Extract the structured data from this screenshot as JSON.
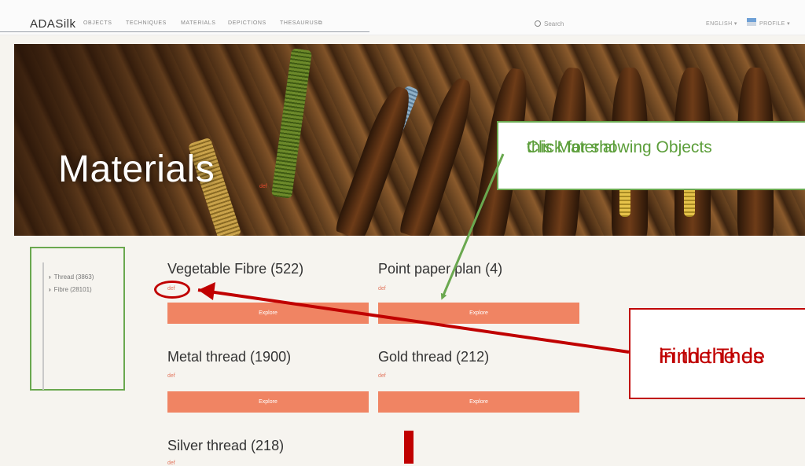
{
  "topbar": {
    "logo": "ADASilk",
    "nav": [
      "OBJECTS",
      "TECHNIQUES",
      "MATERIALS",
      "DEPICTIONS",
      "THESAURUS⧉"
    ],
    "search_placeholder": "Search",
    "language": "ENGLISH ▾",
    "profile": "PROFILE ▾"
  },
  "hero": {
    "title": "Materials",
    "def_link": "def"
  },
  "sidebar": {
    "items": [
      {
        "label": "Thread (3863)"
      },
      {
        "label": "Fibre (28101)"
      }
    ]
  },
  "cards": [
    {
      "title": "Vegetable Fibre (522)",
      "def": "def",
      "button": "Explore"
    },
    {
      "title": "Point paper plan (4)",
      "def": "def",
      "button": "Explore"
    },
    {
      "title": "Metal thread (1900)",
      "def": "def",
      "button": "Explore"
    },
    {
      "title": "Gold thread (212)",
      "def": "def",
      "button": "Explore"
    },
    {
      "title": "Silver thread (218)",
      "def": "def"
    }
  ],
  "annotations": {
    "objects_callout_line1": "Click for showing Objects",
    "objects_callout_line2": "this Material",
    "thesaurus_callout_line1": "Find the de",
    "thesaurus_callout_line2": "in the Thes"
  },
  "colors": {
    "explore_button": "#f08463",
    "green_annotation": "#6aa84f",
    "red_annotation": "#c00000"
  }
}
